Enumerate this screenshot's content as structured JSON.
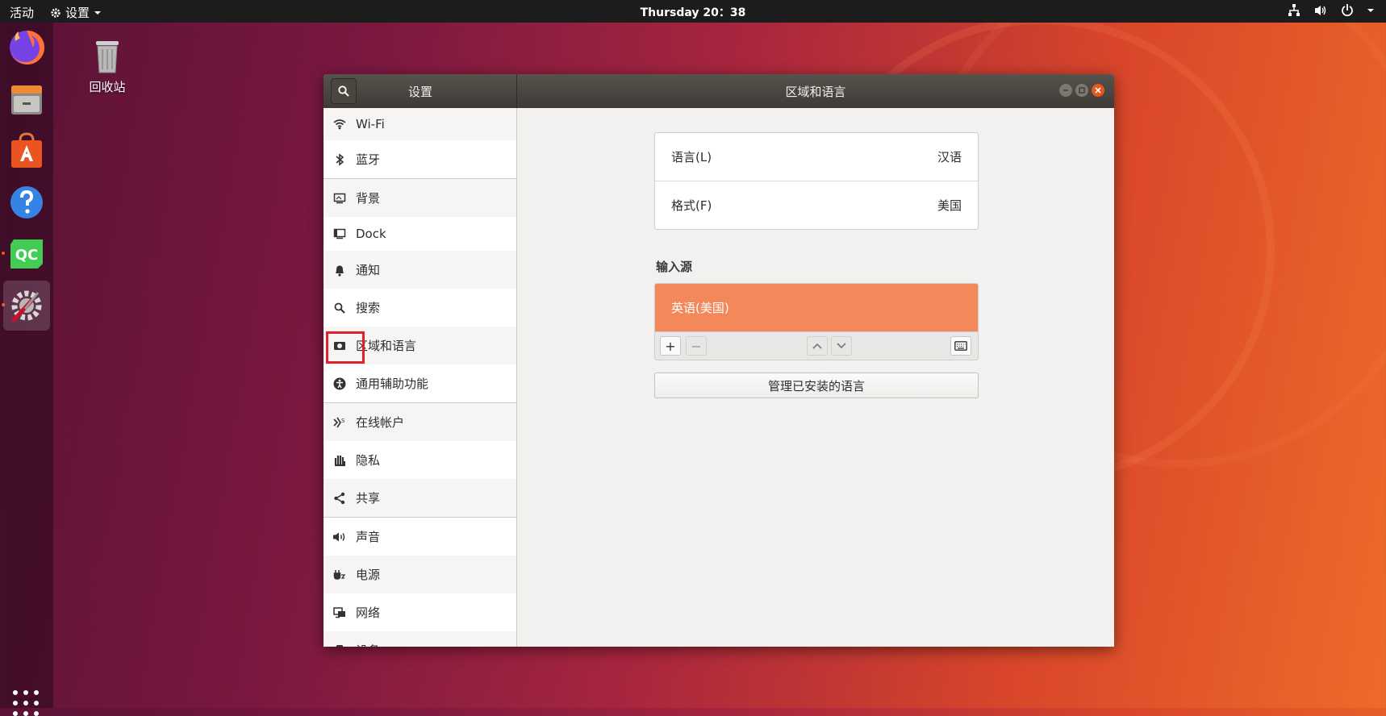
{
  "topbar": {
    "activities": "活动",
    "app_menu": "设置",
    "clock": "Thursday 20：38"
  },
  "desktop": {
    "trash_label": "回收站"
  },
  "window": {
    "sidebar_title": "设置",
    "main_title": "区域和语言"
  },
  "sidebar": {
    "items": [
      {
        "label": "Wi-Fi",
        "icon": "wifi-icon"
      },
      {
        "label": "蓝牙",
        "icon": "bluetooth-icon"
      },
      {
        "label": "背景",
        "icon": "background-icon"
      },
      {
        "label": "Dock",
        "icon": "dock-icon"
      },
      {
        "label": "通知",
        "icon": "bell-icon"
      },
      {
        "label": "搜索",
        "icon": "search-icon"
      },
      {
        "label": "区域和语言",
        "icon": "region-icon"
      },
      {
        "label": "通用辅助功能",
        "icon": "accessibility-icon"
      },
      {
        "label": "在线帐户",
        "icon": "online-accounts-icon"
      },
      {
        "label": "隐私",
        "icon": "privacy-hand-icon"
      },
      {
        "label": "共享",
        "icon": "share-icon"
      },
      {
        "label": "声音",
        "icon": "speaker-icon"
      },
      {
        "label": "电源",
        "icon": "power-plug-icon"
      },
      {
        "label": "网络",
        "icon": "network-icon"
      },
      {
        "label": "设备",
        "icon": "devices-icon"
      }
    ]
  },
  "region": {
    "language_label": "语言(L)",
    "language_value": "汉语",
    "format_label": "格式(F)",
    "format_value": "美国",
    "input_sources_label": "输入源",
    "input_sources": [
      "英语(美国)"
    ],
    "add_symbol": "+",
    "remove_symbol": "−",
    "manage_button": "管理已安装的语言"
  },
  "colors": {
    "selected_input": "#f3895a",
    "accent": "#e95420",
    "highlight_box": "#e0202a"
  }
}
